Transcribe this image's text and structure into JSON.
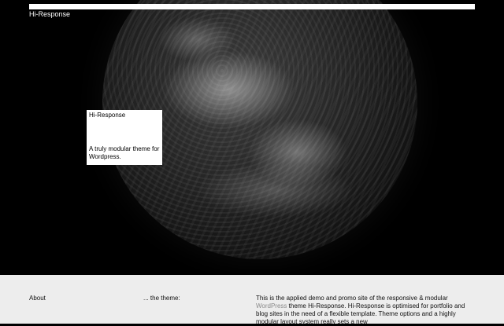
{
  "header": {
    "site_title": "Hi-Response"
  },
  "hero_card": {
    "title": "Hi-Response",
    "tagline": "A truly modular theme for Wordpress."
  },
  "footer": {
    "about_label": "About",
    "theme_label": "... the theme:",
    "text_before_link": "This is the applied demo and promo site of the responsive & modular ",
    "wordpress_link": "WordPress",
    "text_after_link": " theme Hi-Response. Hi-Response is optimised for portfolio and blog sites in the need of a flexible template. Theme options and a highly modular layout system really sets a new"
  },
  "colors": {
    "background": "#000000",
    "footer_bg": "#ededed",
    "card_bg": "#ffffff",
    "link": "#8a8a8a"
  }
}
